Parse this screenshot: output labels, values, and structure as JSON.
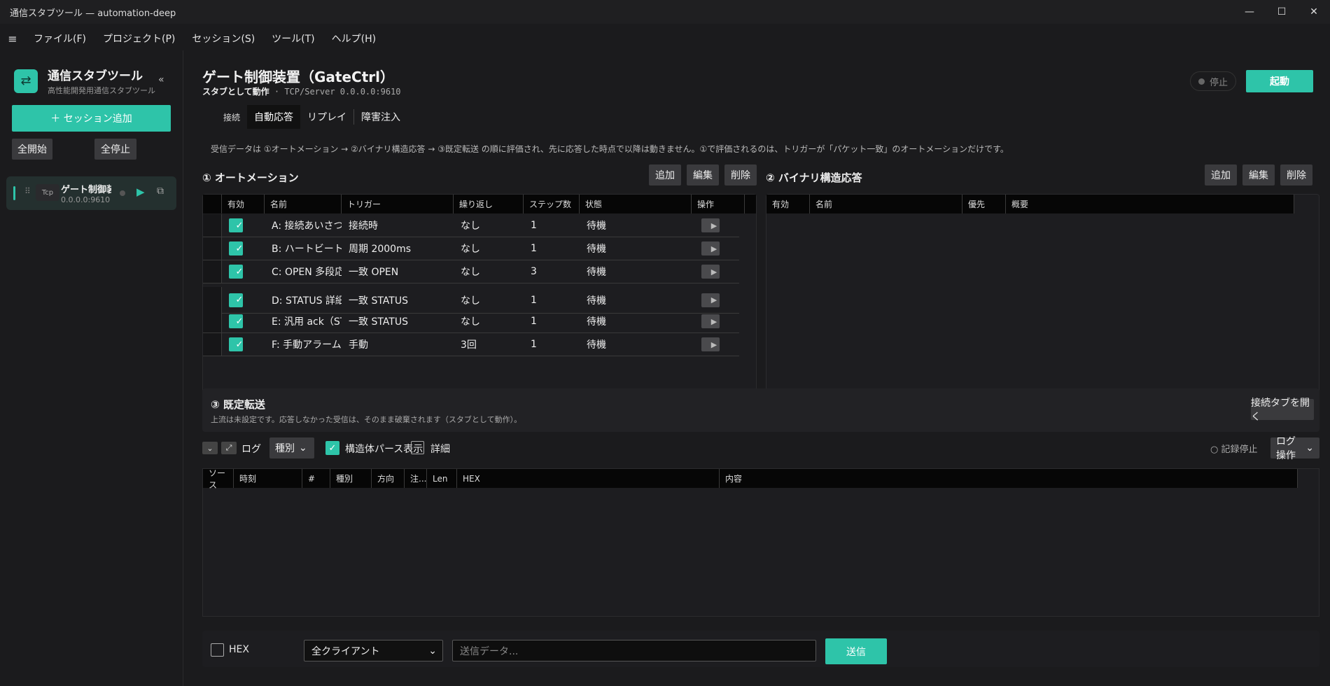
{
  "window": {
    "title": "通信スタブツール — automation-deep",
    "minimize": "—",
    "maximize": "☐",
    "close": "✕"
  },
  "menu": {
    "hamburger": "≡",
    "items": [
      "ファイル(F)",
      "プロジェクト(P)",
      "セッション(S)",
      "ツール(T)",
      "ヘルプ(H)"
    ]
  },
  "sidebar": {
    "brand_title": "通信スタブツール",
    "brand_sub": "高性能開発用通信スタブツール",
    "collapse": "«",
    "add_session": "＋ セッション追加",
    "start_all": "全開始",
    "stop_all": "全停止",
    "session": {
      "type": "Tcp",
      "name": "ゲート制御装置",
      "address": "0.0.0.0:9610"
    }
  },
  "header": {
    "title": "ゲート制御装置（GateCtrl）",
    "mode": "スタブとして動作",
    "endpoint": " · TCP/Server 0.0.0.0:9610",
    "status": "停止",
    "start": "起動"
  },
  "tabs": [
    "接続",
    "自動応答",
    "リプレイ",
    "障害注入"
  ],
  "info": "受信データは ①オートメーション → ②バイナリ構造応答 → ③既定転送 の順に評価され、先に応答した時点で以降は動きません。①で評価されるのは、トリガーが「パケット一致」のオートメーションだけです。",
  "automation": {
    "title": "① オートメーション",
    "buttons": {
      "add": "追加",
      "edit": "編集",
      "delete": "削除"
    },
    "columns": [
      "有効",
      "名前",
      "トリガー",
      "繰り返し",
      "ステップ数",
      "状態",
      "操作"
    ],
    "rows": [
      {
        "name": "A: 接続あいさつ",
        "trigger": "接続時",
        "repeat": "なし",
        "steps": "1",
        "state": "待機"
      },
      {
        "name": "B: ハートビート（周期）",
        "trigger": "周期 2000ms",
        "repeat": "なし",
        "steps": "1",
        "state": "待機"
      },
      {
        "name": "C: OPEN 多段応答",
        "trigger": "一致 OPEN",
        "repeat": "なし",
        "steps": "3",
        "state": "待機"
      },
      {
        "name": "D: STATUS 詳細応答",
        "trigger": "一致 STATUS",
        "repeat": "なし",
        "steps": "1",
        "state": "待機"
      },
      {
        "name": "E: 汎用 ack（STATUS）",
        "trigger": "一致 STATUS",
        "repeat": "なし",
        "steps": "1",
        "state": "待機"
      },
      {
        "name": "F: 手動アラーム（手動）",
        "trigger": "手動",
        "repeat": "3回",
        "steps": "1",
        "state": "待機"
      }
    ]
  },
  "binary": {
    "title": "② バイナリ構造応答",
    "buttons": {
      "add": "追加",
      "edit": "編集",
      "delete": "削除"
    },
    "columns": [
      "有効",
      "名前",
      "優先",
      "概要"
    ]
  },
  "forward": {
    "title": "③ 既定転送",
    "desc": "上流は未設定です。応答しなかった受信は、そのまま破棄されます（スタブとして動作）。",
    "open_tab": "接続タブを開く"
  },
  "log": {
    "label": "ログ",
    "kind": "種別",
    "parse_label": "構造体パース表示",
    "detail_label": "詳細",
    "record_stop": "○ 記録停止",
    "ops": "ログ操作",
    "columns": [
      "ソース",
      "時刻",
      "#",
      "種別",
      "方向",
      "注...",
      "Len",
      "HEX",
      "内容"
    ]
  },
  "send": {
    "hex_label": "HEX",
    "target": "全クライアント",
    "placeholder": "送信データ...",
    "send": "送信"
  }
}
